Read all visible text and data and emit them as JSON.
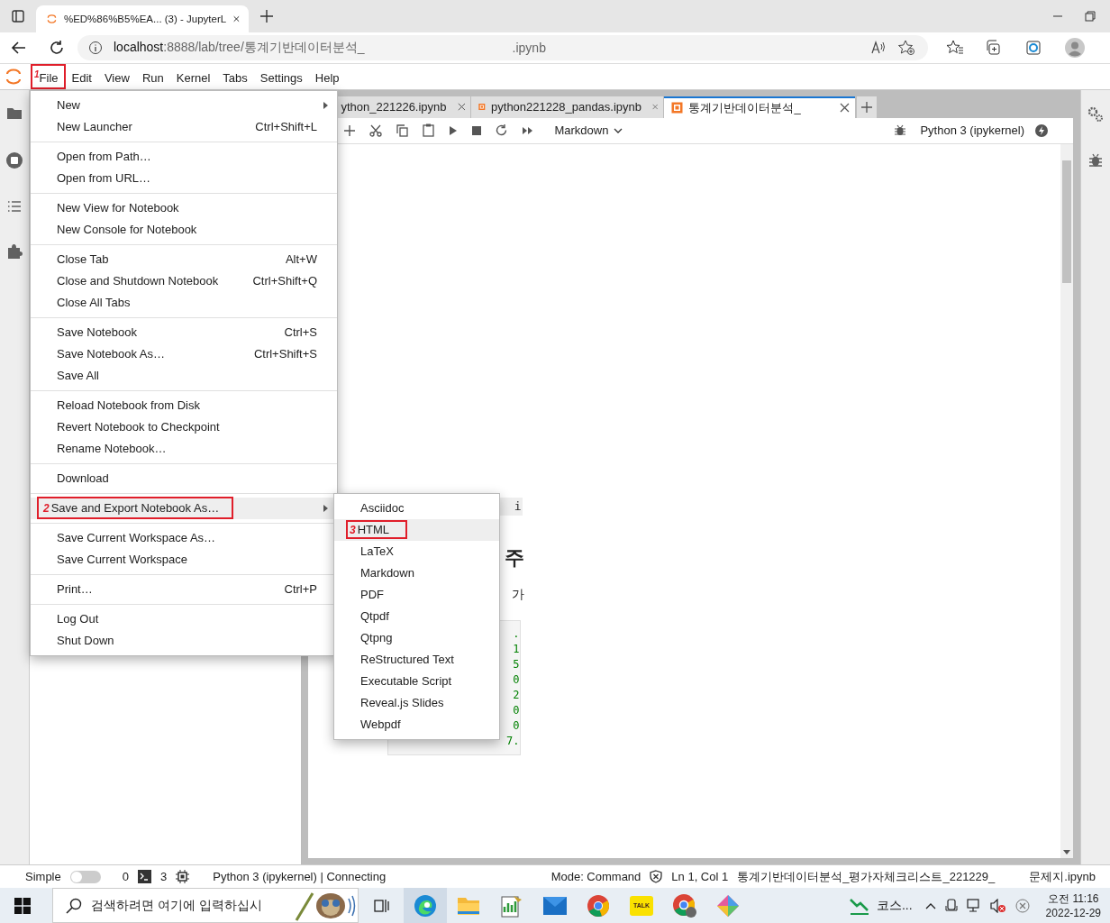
{
  "browser": {
    "tab_title": "%ED%86%B5%EA... (3) - JupyterL",
    "address_host": "localhost",
    "address_rest": ":8888/lab/tree/통계기반데이터분석_",
    "address_tail": ".ipynb"
  },
  "menubar": [
    {
      "label": "File",
      "annotation": "1"
    },
    {
      "label": "Edit"
    },
    {
      "label": "View"
    },
    {
      "label": "Run"
    },
    {
      "label": "Kernel"
    },
    {
      "label": "Tabs"
    },
    {
      "label": "Settings"
    },
    {
      "label": "Help"
    }
  ],
  "file_menu": [
    [
      {
        "label": "New",
        "submenu": true,
        "selected": false
      },
      {
        "label": "New Launcher",
        "shortcut": "Ctrl+Shift+L",
        "selected": false
      }
    ],
    [
      {
        "label": "Open from Path…",
        "selected": false
      },
      {
        "label": "Open from URL…",
        "selected": false
      }
    ],
    [
      {
        "label": "New View for Notebook",
        "selected": false
      },
      {
        "label": "New Console for Notebook",
        "selected": false
      }
    ],
    [
      {
        "label": "Close Tab",
        "shortcut": "Alt+W",
        "selected": false
      },
      {
        "label": "Close and Shutdown Notebook",
        "shortcut": "Ctrl+Shift+Q",
        "selected": false
      },
      {
        "label": "Close All Tabs",
        "selected": false
      }
    ],
    [
      {
        "label": "Save Notebook",
        "shortcut": "Ctrl+S",
        "selected": false
      },
      {
        "label": "Save Notebook As…",
        "shortcut": "Ctrl+Shift+S",
        "selected": false
      },
      {
        "label": "Save All",
        "selected": false
      }
    ],
    [
      {
        "label": "Reload Notebook from Disk",
        "selected": false
      },
      {
        "label": "Revert Notebook to Checkpoint",
        "selected": false
      },
      {
        "label": "Rename Notebook…",
        "selected": false
      }
    ],
    [
      {
        "label": "Download",
        "selected": false
      }
    ],
    [
      {
        "label": "Save and Export Notebook As…",
        "submenu": true,
        "selected": true,
        "annotation": "2"
      }
    ],
    [
      {
        "label": "Save Current Workspace As…",
        "selected": false
      },
      {
        "label": "Save Current Workspace",
        "selected": false
      }
    ],
    [
      {
        "label": "Print…",
        "shortcut": "Ctrl+P",
        "selected": false
      }
    ],
    [
      {
        "label": "Log Out",
        "selected": false
      },
      {
        "label": "Shut Down",
        "selected": false
      }
    ]
  ],
  "export_menu": [
    {
      "label": "Asciidoc",
      "selected": false
    },
    {
      "label": "HTML",
      "selected": true,
      "annotation": "3"
    },
    {
      "label": "LaTeX",
      "selected": false
    },
    {
      "label": "Markdown",
      "selected": false
    },
    {
      "label": "PDF",
      "selected": false
    },
    {
      "label": "Qtpdf",
      "selected": false
    },
    {
      "label": "Qtpng",
      "selected": false
    },
    {
      "label": "ReStructured Text",
      "selected": false
    },
    {
      "label": "Executable Script",
      "selected": false
    },
    {
      "label": "Reveal.js Slides",
      "selected": false
    },
    {
      "label": "Webpdf",
      "selected": false
    }
  ],
  "notebook_tabs": [
    {
      "label": "ython_221226.ipynb",
      "selected": false
    },
    {
      "label": "python221228_pandas.ipynb",
      "selected": false
    },
    {
      "label": "통계기반데이터분석_",
      "selected": true
    }
  ],
  "toolbar": {
    "cell_type": "Markdown",
    "kernel": "Python 3 (ipykernel)"
  },
  "notebook": {
    "inline_code": "i",
    "heading": "주",
    "text": "가",
    "code_lines": [
      ".",
      "1",
      "5",
      "0",
      "2",
      "0",
      "0",
      "7."
    ]
  },
  "status_bar": {
    "mode_label": "Simple",
    "simple_on": false,
    "terminals": "0",
    "kernels": "3",
    "kernel_status": "Python 3 (ipykernel) | Connecting",
    "mode": "Mode: Command",
    "position": "Ln 1, Col 1",
    "file_path": "통계기반데이터분석_평가자체크리스트_221229_",
    "file_tail": "문제지.ipynb"
  },
  "taskbar": {
    "search_placeholder": "검색하려면 여기에 입력하십시",
    "talk_label": "TALK",
    "tray_app": "코스...",
    "time": "오전 11:16",
    "date": "2022-12-29"
  }
}
